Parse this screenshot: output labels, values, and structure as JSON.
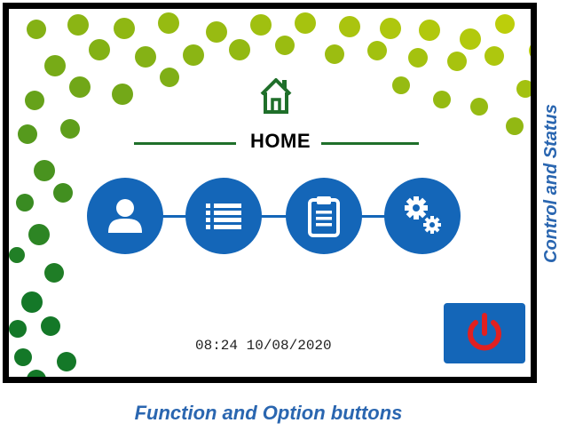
{
  "screen": {
    "title": "HOME",
    "datetime": "08:24 10/08/2020"
  },
  "buttons": [
    {
      "name": "user",
      "icon": "user-icon"
    },
    {
      "name": "list",
      "icon": "list-icon"
    },
    {
      "name": "clipboard",
      "icon": "clipboard-icon"
    },
    {
      "name": "settings",
      "icon": "gears-icon"
    }
  ],
  "power": {
    "icon": "power-icon"
  },
  "labels": {
    "side": "Control and Status",
    "bottom": "Function and Option buttons"
  },
  "colors": {
    "accent_blue": "#1466b8",
    "green": "#1f6f2a",
    "power_red": "#e02020",
    "label_blue": "#2a66b0"
  }
}
